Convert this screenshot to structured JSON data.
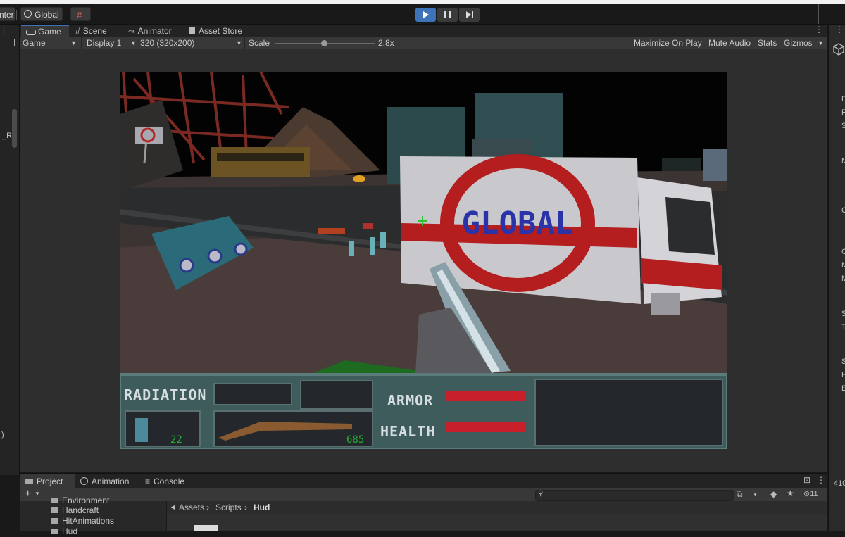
{
  "toolbar": {
    "center_label": "nter",
    "global_label": "Global",
    "play_icon": "play-icon",
    "pause_icon": "pause-icon",
    "step_icon": "step-icon"
  },
  "game_tabs": [
    {
      "label": "Game",
      "icon": "gamepad-icon",
      "active": true
    },
    {
      "label": "Scene",
      "icon": "grid-icon",
      "active": false
    },
    {
      "label": "Animator",
      "icon": "animator-icon",
      "active": false
    },
    {
      "label": "Asset Store",
      "icon": "bag-icon",
      "active": false
    }
  ],
  "game_toolbar": {
    "view_mode": "Game",
    "display": "Display 1",
    "resolution": "320 (320x200)",
    "scale_label": "Scale",
    "scale_value": "2.8x",
    "scale_fraction": 0.49,
    "maximize_on_play": "Maximize On Play",
    "mute_audio": "Mute Audio",
    "stats": "Stats",
    "gizmos": "Gizmos"
  },
  "hud": {
    "radiation_label": "RADIATION",
    "armor_label": "ARMOR",
    "health_label": "HEALTH",
    "grenade_count": "22",
    "ammo_count": "685",
    "armor_fraction": 1.0,
    "health_fraction": 1.0,
    "bar_color": "#c8202a",
    "truck_logo": "GLOBAL"
  },
  "left_panel": {
    "label_r": "_R",
    "label_paren": ")"
  },
  "bottom_tabs": [
    {
      "label": "Project",
      "icon": "folder-icon",
      "active": true
    },
    {
      "label": "Animation",
      "icon": "clock-icon",
      "active": false
    },
    {
      "label": "Console",
      "icon": "console-icon",
      "active": false
    }
  ],
  "project": {
    "add_label": "+",
    "hidden_count": "11",
    "tree": [
      "Environment",
      "Handcraft",
      "HitAnimations",
      "Hud"
    ],
    "breadcrumb": [
      "Assets",
      "Scripts",
      "Hud"
    ]
  },
  "right_panel": {
    "letters": [
      "P",
      "R",
      "S",
      "M",
      "C",
      "C",
      "M",
      "M",
      "S",
      "T",
      "S",
      "H",
      "E"
    ],
    "bottom_number": "410"
  }
}
